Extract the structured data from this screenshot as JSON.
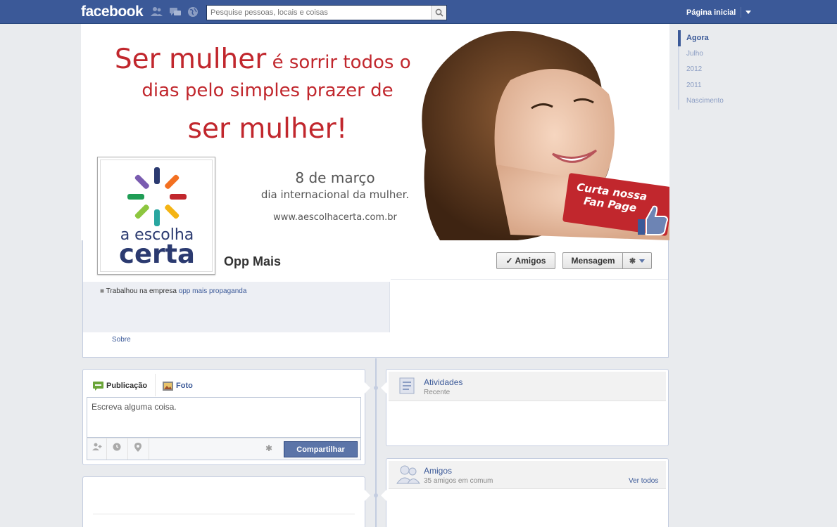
{
  "topbar": {
    "logo": "facebook",
    "search_placeholder": "Pesquise pessoas, locais e coisas",
    "home_label": "Página inicial",
    "icons": [
      "friends-icon",
      "messages-icon",
      "notifications-globe-icon"
    ]
  },
  "timeline_nav": {
    "items": [
      {
        "label": "Agora",
        "active": true
      },
      {
        "label": "Julho",
        "active": false
      },
      {
        "label": "2012",
        "active": false
      },
      {
        "label": "2011",
        "active": false
      },
      {
        "label": "Nascimento",
        "active": false
      }
    ]
  },
  "cover": {
    "line1_big": "Ser mulher",
    "line1_small": " é sorrir todos os",
    "line2": "dias pelo simples prazer de",
    "line3": "ser mulher!",
    "date": "8 de março",
    "occasion": "dia internacional da mulher.",
    "url": "www.aescolhacerta.com.br",
    "badge_line1": "Curta nossa",
    "badge_line2": "Fan Page",
    "accent_color": "#c1272d"
  },
  "profile": {
    "logo_line1": "a escolha",
    "logo_line2": "certa",
    "name": "Opp Mais",
    "friends_button": "✓ Amigos",
    "message_button": "Mensagem",
    "work_prefix": "Trabalhou na empresa ",
    "work_company": "opp mais propaganda",
    "about_link": "Sobre"
  },
  "composer": {
    "tab_post": "Publicação",
    "tab_photo": "Foto",
    "placeholder": "Escreva alguma coisa.",
    "share_button": "Compartilhar"
  },
  "activity": {
    "title": "Atividades",
    "subtitle": "Recente"
  },
  "friends": {
    "title": "Amigos",
    "subtitle": "35 amigos em comum",
    "see_all": "Ver todos"
  },
  "colors": {
    "brand": "#3b5998",
    "background": "#e9ebee",
    "share_button": "#5b74a8"
  }
}
